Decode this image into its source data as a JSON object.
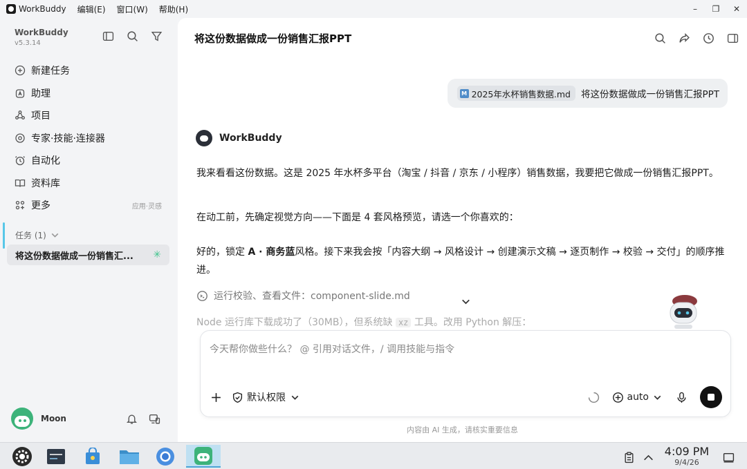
{
  "titlebar": {
    "app_name": "WorkBuddy",
    "menus": [
      "编辑(E)",
      "窗口(W)",
      "帮助(H)"
    ],
    "minimize": "–",
    "maximize": "❐",
    "close": "✕"
  },
  "sidebar": {
    "brand": "WorkBuddy",
    "version": "v5.3.14",
    "nav": [
      {
        "label": "新建任务",
        "icon": "new-task-icon"
      },
      {
        "label": "助理",
        "icon": "assistant-icon"
      },
      {
        "label": "项目",
        "icon": "project-icon"
      },
      {
        "label": "专家·技能·连接器",
        "icon": "expert-icon"
      },
      {
        "label": "自动化",
        "icon": "automation-icon"
      },
      {
        "label": "资料库",
        "icon": "library-icon"
      },
      {
        "label": "更多",
        "icon": "more-icon",
        "extra": "应用·灵感"
      }
    ],
    "tasks_header": "任务 (1)",
    "active_task": "将这份数据做成一份销售汇...",
    "user_name": "Moon"
  },
  "main": {
    "title": "将这份数据做成一份销售汇报PPT",
    "user_message": {
      "file_name": "2025年水杯销售数据.md",
      "text": "将这份数据做成一份销售汇报PPT"
    },
    "bot_name": "WorkBuddy",
    "paragraph1": "我来看看这份数据。这是 2025 年水杯多平台（淘宝 / 抖音 / 京东 / 小程序）销售数据，我要把它做成一份销售汇报PPT。",
    "paragraph2": "在动工前，先确定视觉方向——下面是 4 套风格预览，请选一个你喜欢的：",
    "paragraph3_prefix": "好的，锁定 ",
    "paragraph3_bold": "A · 商务蓝",
    "paragraph3_suffix": "风格。接下来我会按「内容大纲 → 风格设计 → 创建演示文稿 → 逐页制作 → 校验 → 交付」的顺序推进。",
    "tool_line": "运行校验、查看文件：component-slide.md",
    "faded_prefix": "Node 运行库下载成功了（30MB），但系统缺 ",
    "faded_code": "xz",
    "faded_suffix": " 工具。改用 Python 解压：",
    "input_placeholder": "今天帮你做些什么？ @ 引用对话文件，/ 调用技能与指令",
    "permission_label": "默认权限",
    "model_label": "auto",
    "disclaimer": "内容由 AI 生成，请核实重要信息"
  },
  "taskbar": {
    "time": "4:09 PM",
    "date": "9/4/26"
  },
  "colors": {
    "accent": "#57c7e8",
    "brand_green": "#3db37a",
    "sidebar_bg": "#f3f4f6"
  }
}
